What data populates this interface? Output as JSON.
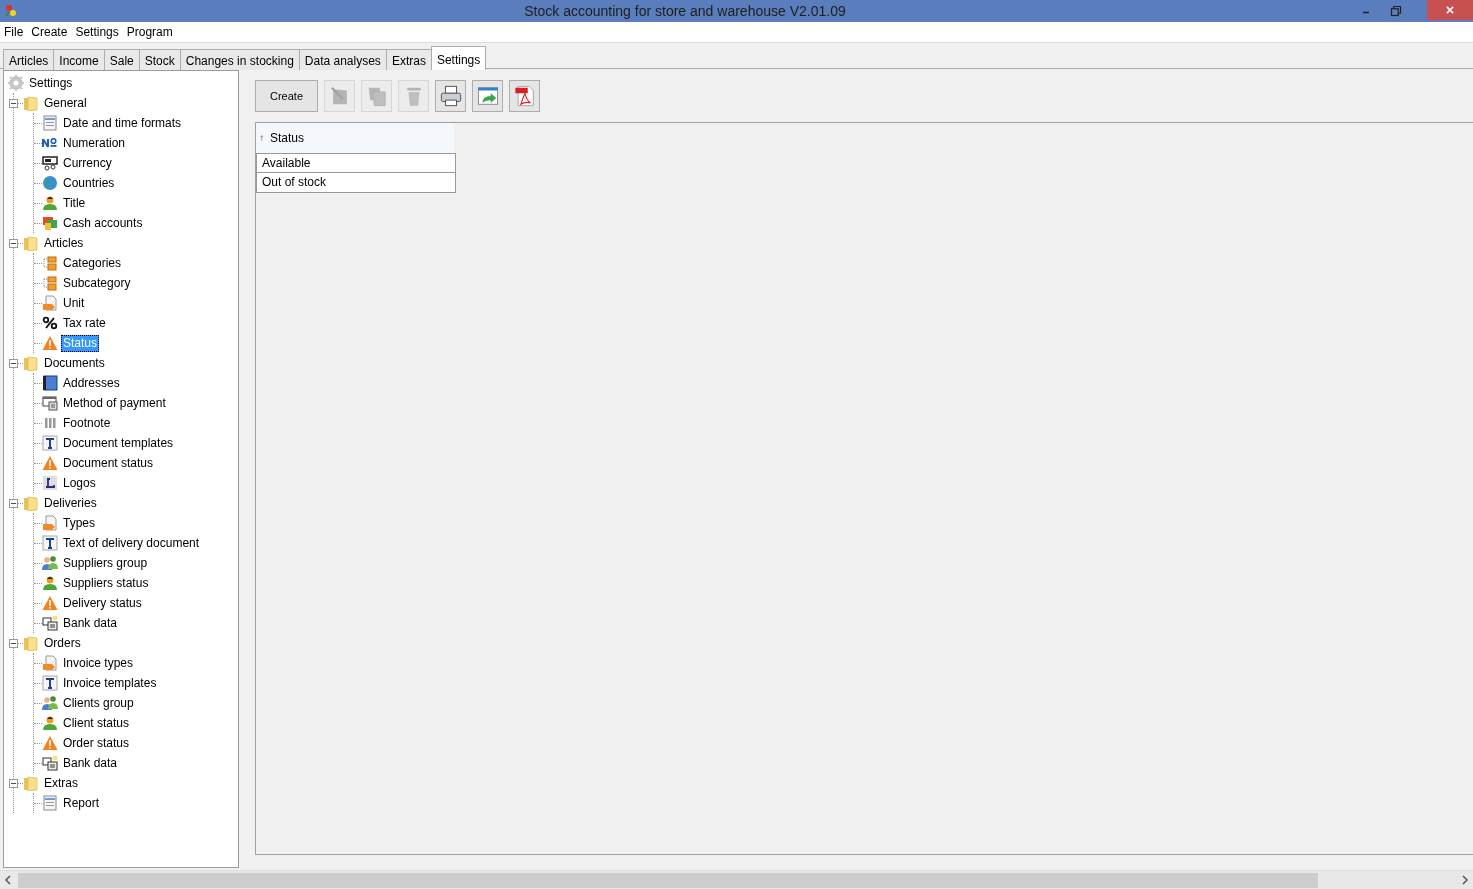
{
  "window": {
    "title": "Stock accounting for store and warehouse V2.01.09"
  },
  "menu": [
    "File",
    "Create",
    "Settings",
    "Program"
  ],
  "tabs": [
    {
      "label": "Articles",
      "selected": false
    },
    {
      "label": "Income",
      "selected": false
    },
    {
      "label": "Sale",
      "selected": false
    },
    {
      "label": "Stock",
      "selected": false
    },
    {
      "label": "Changes in stocking",
      "selected": false
    },
    {
      "label": "Data analyses",
      "selected": false
    },
    {
      "label": "Extras",
      "selected": false
    },
    {
      "label": "Settings",
      "selected": true
    }
  ],
  "tree": {
    "label": "Settings",
    "groups": [
      {
        "label": "General",
        "expanded": true,
        "children": [
          {
            "label": "Date and time formats",
            "kind": "form",
            "selected": false
          },
          {
            "label": "Numeration",
            "kind": "numero",
            "selected": false
          },
          {
            "label": "Currency",
            "kind": "register",
            "selected": false
          },
          {
            "label": "Countries",
            "kind": "globe",
            "selected": false
          },
          {
            "label": "Title",
            "kind": "person",
            "selected": false
          },
          {
            "label": "Cash accounts",
            "kind": "cash",
            "selected": false
          }
        ]
      },
      {
        "label": "Articles",
        "expanded": true,
        "children": [
          {
            "label": "Categories",
            "kind": "boxes",
            "selected": false
          },
          {
            "label": "Subcategory",
            "kind": "boxes",
            "selected": false
          },
          {
            "label": "Unit",
            "kind": "tag",
            "selected": false
          },
          {
            "label": "Tax rate",
            "kind": "percent",
            "selected": false
          },
          {
            "label": "Status",
            "kind": "warning",
            "selected": true
          }
        ]
      },
      {
        "label": "Documents",
        "expanded": true,
        "children": [
          {
            "label": "Addresses",
            "kind": "book",
            "selected": false
          },
          {
            "label": "Method of payment",
            "kind": "payment",
            "selected": false
          },
          {
            "label": "Footnote",
            "kind": "columns",
            "selected": false
          },
          {
            "label": "Document templates",
            "kind": "text",
            "selected": false
          },
          {
            "label": "Document status",
            "kind": "warning",
            "selected": false
          },
          {
            "label": "Logos",
            "kind": "logo",
            "selected": false
          }
        ]
      },
      {
        "label": "Deliveries",
        "expanded": true,
        "children": [
          {
            "label": "Types",
            "kind": "tag",
            "selected": false
          },
          {
            "label": "Text of delivery document",
            "kind": "text",
            "selected": false
          },
          {
            "label": "Suppliers group",
            "kind": "group",
            "selected": false
          },
          {
            "label": "Suppliers status",
            "kind": "person",
            "selected": false
          },
          {
            "label": "Delivery status",
            "kind": "warning",
            "selected": false
          },
          {
            "label": "Bank data",
            "kind": "bank",
            "selected": false
          }
        ]
      },
      {
        "label": "Orders",
        "expanded": true,
        "children": [
          {
            "label": "Invoice types",
            "kind": "tag",
            "selected": false
          },
          {
            "label": "Invoice templates",
            "kind": "text",
            "selected": false
          },
          {
            "label": "Clients group",
            "kind": "group",
            "selected": false
          },
          {
            "label": "Client status",
            "kind": "person",
            "selected": false
          },
          {
            "label": "Order status",
            "kind": "warning",
            "selected": false
          },
          {
            "label": "Bank data",
            "kind": "bank",
            "selected": false
          }
        ]
      },
      {
        "label": "Extras",
        "expanded": true,
        "children": [
          {
            "label": "Report",
            "kind": "form",
            "selected": false
          }
        ]
      }
    ]
  },
  "toolbar": [
    {
      "kind": "text",
      "label": "Create",
      "disabled": false
    },
    {
      "kind": "edit",
      "disabled": true
    },
    {
      "kind": "copy",
      "disabled": true
    },
    {
      "kind": "delete",
      "disabled": true
    },
    {
      "kind": "print",
      "disabled": false
    },
    {
      "kind": "export",
      "disabled": false
    },
    {
      "kind": "pdf",
      "disabled": false
    }
  ],
  "table": {
    "columns": [
      {
        "label": "Status",
        "sorted": true
      }
    ],
    "rows": [
      [
        "Available"
      ],
      [
        "Out of stock"
      ]
    ]
  }
}
